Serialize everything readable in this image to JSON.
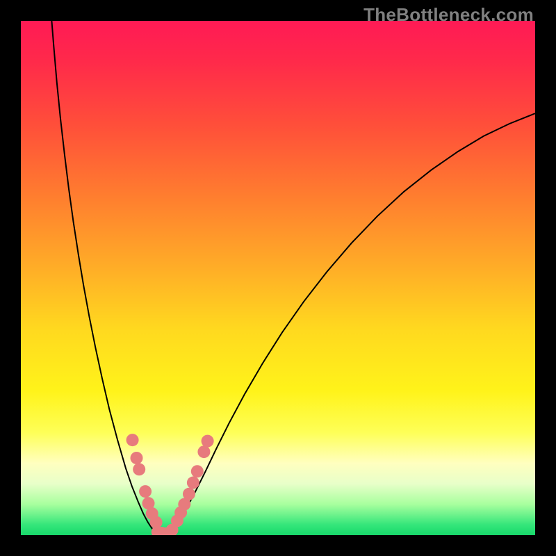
{
  "watermark": "TheBottleneck.com",
  "chart_data": {
    "type": "line",
    "title": "",
    "xlabel": "",
    "ylabel": "",
    "xlim": [
      0,
      100
    ],
    "ylim": [
      0,
      100
    ],
    "legend": false,
    "grid": false,
    "background_gradient": {
      "stops": [
        {
          "offset": 0.0,
          "color": "#ff1a55"
        },
        {
          "offset": 0.08,
          "color": "#ff2a4a"
        },
        {
          "offset": 0.2,
          "color": "#ff4e3a"
        },
        {
          "offset": 0.34,
          "color": "#ff7d2f"
        },
        {
          "offset": 0.48,
          "color": "#ffad27"
        },
        {
          "offset": 0.6,
          "color": "#ffd91f"
        },
        {
          "offset": 0.72,
          "color": "#fff31a"
        },
        {
          "offset": 0.8,
          "color": "#feff57"
        },
        {
          "offset": 0.86,
          "color": "#ffffbf"
        },
        {
          "offset": 0.9,
          "color": "#e8ffc9"
        },
        {
          "offset": 0.94,
          "color": "#a8ff9e"
        },
        {
          "offset": 0.98,
          "color": "#34e67a"
        },
        {
          "offset": 1.0,
          "color": "#18d86b"
        }
      ]
    },
    "series": [
      {
        "name": "left-curve",
        "stroke": "#000000",
        "stroke_width": 2,
        "points": [
          [
            6.0,
            100.0
          ],
          [
            6.4,
            95.0
          ],
          [
            7.0,
            88.0
          ],
          [
            7.7,
            81.0
          ],
          [
            8.5,
            74.0
          ],
          [
            9.3,
            67.5
          ],
          [
            10.2,
            61.0
          ],
          [
            11.2,
            54.5
          ],
          [
            12.2,
            48.5
          ],
          [
            13.3,
            42.5
          ],
          [
            14.5,
            36.5
          ],
          [
            15.8,
            30.5
          ],
          [
            17.2,
            24.5
          ],
          [
            18.8,
            18.5
          ],
          [
            20.4,
            13.0
          ],
          [
            21.6,
            9.5
          ],
          [
            22.8,
            6.5
          ],
          [
            23.8,
            4.2
          ],
          [
            24.7,
            2.5
          ],
          [
            25.5,
            1.3
          ],
          [
            26.3,
            0.5
          ],
          [
            27.0,
            0.1
          ],
          [
            27.6,
            0.0
          ]
        ]
      },
      {
        "name": "right-curve",
        "stroke": "#000000",
        "stroke_width": 2,
        "points": [
          [
            27.6,
            0.0
          ],
          [
            28.3,
            0.2
          ],
          [
            29.1,
            0.8
          ],
          [
            30.0,
            1.8
          ],
          [
            31.0,
            3.2
          ],
          [
            32.3,
            5.4
          ],
          [
            33.9,
            8.4
          ],
          [
            35.9,
            12.4
          ],
          [
            38.0,
            16.8
          ],
          [
            40.5,
            21.8
          ],
          [
            43.5,
            27.4
          ],
          [
            47.0,
            33.4
          ],
          [
            50.8,
            39.4
          ],
          [
            55.0,
            45.4
          ],
          [
            59.5,
            51.2
          ],
          [
            64.3,
            56.8
          ],
          [
            69.3,
            62.0
          ],
          [
            74.5,
            66.8
          ],
          [
            79.8,
            71.0
          ],
          [
            85.0,
            74.6
          ],
          [
            90.0,
            77.6
          ],
          [
            95.0,
            80.0
          ],
          [
            100.0,
            82.0
          ]
        ]
      }
    ],
    "scatter": {
      "name": "markers",
      "fill": "#e77b7d",
      "radius": 9,
      "points": [
        [
          21.7,
          18.5
        ],
        [
          22.5,
          15.0
        ],
        [
          23.0,
          12.8
        ],
        [
          24.2,
          8.5
        ],
        [
          24.8,
          6.2
        ],
        [
          25.5,
          4.2
        ],
        [
          26.3,
          2.5
        ],
        [
          26.6,
          0.6
        ],
        [
          27.4,
          0.4
        ],
        [
          28.2,
          0.3
        ],
        [
          29.4,
          1.0
        ],
        [
          30.4,
          2.8
        ],
        [
          31.1,
          4.4
        ],
        [
          31.8,
          6.0
        ],
        [
          32.7,
          8.0
        ],
        [
          33.5,
          10.2
        ],
        [
          34.3,
          12.4
        ],
        [
          35.6,
          16.2
        ],
        [
          36.3,
          18.3
        ]
      ]
    }
  }
}
